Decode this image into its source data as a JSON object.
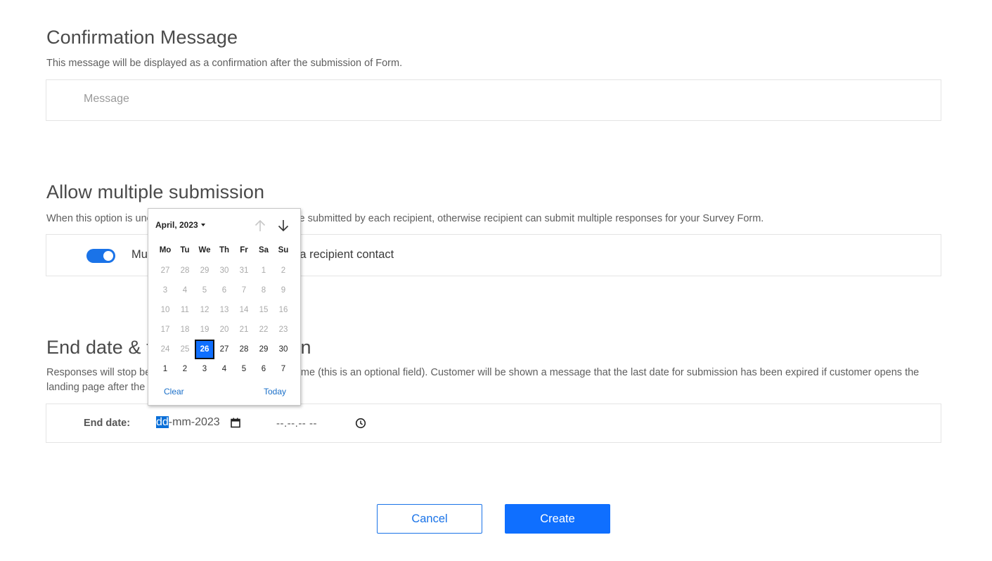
{
  "confirmation": {
    "title": "Confirmation Message",
    "description": "This message will be displayed as a confirmation after the submission of Form.",
    "message_placeholder": "Message"
  },
  "multiple": {
    "title": "Allow multiple submission",
    "description": "When this option is unchecked, only one response will be submitted by each recipient, otherwise recipient can submit multiple responses for your Survey Form.",
    "toggle_on": true,
    "toggle_label": "Multiple submissions allowed by a recipient contact"
  },
  "enddate": {
    "title": "End date & time for submission",
    "description": "Responses will stop being accepted after this date and time (this is an optional field). Customer will be shown a message that the last date for submission has been expired if customer opens the landing page after the end date.",
    "label": "End date:",
    "date_dd": "dd",
    "date_rest": "-mm-2023",
    "time_value": "--.--.-- --"
  },
  "buttons": {
    "cancel": "Cancel",
    "create": "Create"
  },
  "datepicker": {
    "month_label": "April, 2023",
    "weekdays": [
      "Mo",
      "Tu",
      "We",
      "Th",
      "Fr",
      "Sa",
      "Su"
    ],
    "days": [
      {
        "d": "27",
        "cur": false
      },
      {
        "d": "28",
        "cur": false
      },
      {
        "d": "29",
        "cur": false
      },
      {
        "d": "30",
        "cur": false
      },
      {
        "d": "31",
        "cur": false
      },
      {
        "d": "1",
        "cur": false
      },
      {
        "d": "2",
        "cur": false
      },
      {
        "d": "3",
        "cur": false
      },
      {
        "d": "4",
        "cur": false
      },
      {
        "d": "5",
        "cur": false
      },
      {
        "d": "6",
        "cur": false
      },
      {
        "d": "7",
        "cur": false
      },
      {
        "d": "8",
        "cur": false
      },
      {
        "d": "9",
        "cur": false
      },
      {
        "d": "10",
        "cur": false
      },
      {
        "d": "11",
        "cur": false
      },
      {
        "d": "12",
        "cur": false
      },
      {
        "d": "13",
        "cur": false
      },
      {
        "d": "14",
        "cur": false
      },
      {
        "d": "15",
        "cur": false
      },
      {
        "d": "16",
        "cur": false
      },
      {
        "d": "17",
        "cur": false
      },
      {
        "d": "18",
        "cur": false
      },
      {
        "d": "19",
        "cur": false
      },
      {
        "d": "20",
        "cur": false
      },
      {
        "d": "21",
        "cur": false
      },
      {
        "d": "22",
        "cur": false
      },
      {
        "d": "23",
        "cur": false
      },
      {
        "d": "24",
        "cur": false
      },
      {
        "d": "25",
        "cur": false
      },
      {
        "d": "26",
        "cur": true,
        "sel": true
      },
      {
        "d": "27",
        "cur": true
      },
      {
        "d": "28",
        "cur": true
      },
      {
        "d": "29",
        "cur": true
      },
      {
        "d": "30",
        "cur": true
      },
      {
        "d": "1",
        "cur": true
      },
      {
        "d": "2",
        "cur": true
      },
      {
        "d": "3",
        "cur": true
      },
      {
        "d": "4",
        "cur": true
      },
      {
        "d": "5",
        "cur": true
      },
      {
        "d": "6",
        "cur": true
      },
      {
        "d": "7",
        "cur": true
      }
    ],
    "clear_label": "Clear",
    "today_label": "Today"
  },
  "colors": {
    "accent": "#0f6fff",
    "toggle": "#1a73e8",
    "link": "#1a6fc9"
  },
  "icons": {
    "calendar": "calendar-icon",
    "clock": "clock-icon",
    "nav_up": "arrow-up-icon",
    "nav_down": "arrow-down-icon"
  }
}
